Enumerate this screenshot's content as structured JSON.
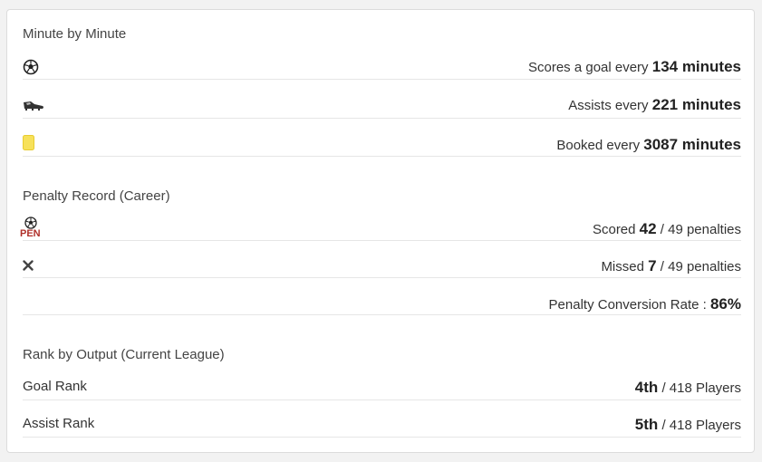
{
  "minute": {
    "title": "Minute by Minute",
    "rows": [
      {
        "icon": "soccer-ball-icon",
        "prefix": "Scores a goal every",
        "value": "134 minutes"
      },
      {
        "icon": "boot-icon",
        "prefix": "Assists every",
        "value": "221 minutes"
      },
      {
        "icon": "yellow-card-icon",
        "prefix": "Booked every",
        "value": "3087 minutes"
      }
    ]
  },
  "penalty": {
    "title": "Penalty Record (Career)",
    "pen_label": "PEN",
    "scored": {
      "prefix": "Scored",
      "value": "42",
      "suffix": "/ 49 penalties"
    },
    "missed": {
      "prefix": "Missed",
      "value": "7",
      "suffix": "/ 49 penalties"
    },
    "rate": {
      "prefix": "Penalty Conversion Rate :",
      "value": "86%"
    }
  },
  "rank": {
    "title": "Rank by Output (Current League)",
    "rows": [
      {
        "label": "Goal Rank",
        "value": "4th",
        "suffix": "/ 418 Players"
      },
      {
        "label": "Assist Rank",
        "value": "5th",
        "suffix": "/ 418 Players"
      }
    ]
  },
  "colors": {
    "card_yellow": "#f7e15a",
    "pen_red": "#b0302a"
  }
}
